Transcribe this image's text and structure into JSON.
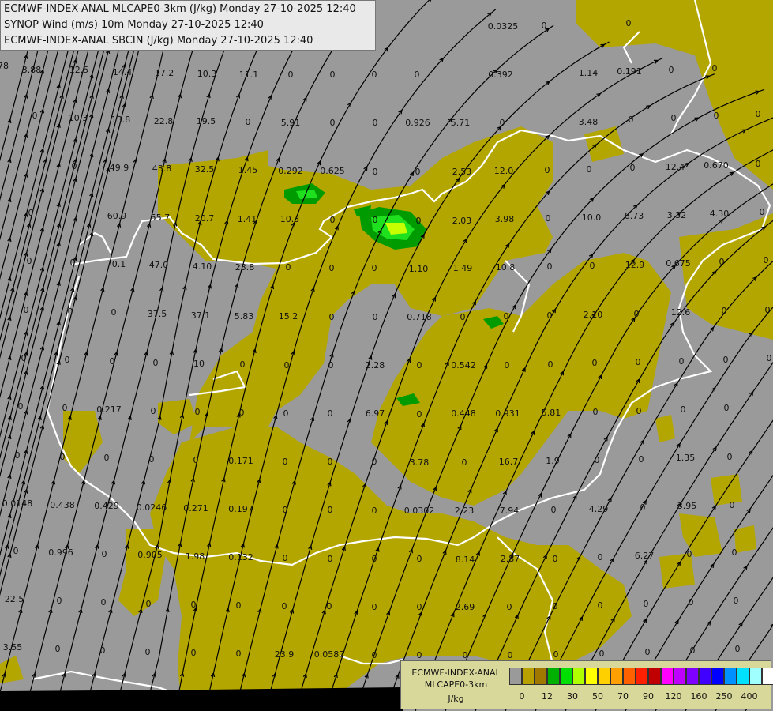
{
  "titles": [
    "ECMWF-INDEX-ANAL MLCAPE0-3km (J/kg) Monday 27-10-2025 12:40",
    "SYNOP Wind (m/s) 10m Monday 27-10-2025 12:40",
    "ECMWF-INDEX-ANAL SBCIN (J/kg) Monday 27-10-2025 12:40"
  ],
  "legend": {
    "line1": "ECMWF-INDEX-ANAL",
    "line2": "MLCAPE0-3km",
    "unit": "J/kg",
    "colors": [
      "#9a9a9a",
      "#b8a000",
      "#a07800",
      "#00b000",
      "#00e000",
      "#b0ff00",
      "#ffff00",
      "#ffd000",
      "#ffa000",
      "#ff6000",
      "#ff2000",
      "#c00000",
      "#ff00ff",
      "#c000ff",
      "#8000ff",
      "#4000ff",
      "#0000ff",
      "#0090ff",
      "#00e0ff",
      "#a0ffff",
      "#ffffff"
    ],
    "ticks": [
      "0",
      "12",
      "30",
      "50",
      "70",
      "90",
      "120",
      "160",
      "250",
      "400"
    ]
  },
  "values": [
    [
      "3.88",
      40,
      92
    ],
    [
      "12.5",
      100,
      92
    ],
    [
      "14.4",
      155,
      95
    ],
    [
      "17.2",
      208,
      96
    ],
    [
      "10.3",
      262,
      97
    ],
    [
      "11.1",
      315,
      98
    ],
    [
      "0",
      368,
      98
    ],
    [
      "0",
      421,
      98
    ],
    [
      "0",
      474,
      98
    ],
    [
      "0",
      528,
      98
    ],
    [
      "0.392",
      634,
      98
    ],
    [
      "1.14",
      745,
      96
    ],
    [
      "0.191",
      797,
      94
    ],
    [
      "0",
      850,
      92
    ],
    [
      "0",
      905,
      90
    ],
    [
      "78",
      4,
      87
    ],
    [
      "0.0325",
      637,
      37
    ],
    [
      "0",
      796,
      33
    ],
    [
      "0",
      689,
      36
    ],
    [
      "0",
      44,
      150
    ],
    [
      "10.3",
      99,
      153
    ],
    [
      "13.8",
      153,
      155
    ],
    [
      "22.8",
      207,
      157
    ],
    [
      "19.5",
      261,
      157
    ],
    [
      "0",
      314,
      158
    ],
    [
      "5.91",
      368,
      159
    ],
    [
      "0",
      421,
      159
    ],
    [
      "0",
      475,
      159
    ],
    [
      "0.926",
      529,
      159
    ],
    [
      "5.71",
      583,
      159
    ],
    [
      "0",
      636,
      159
    ],
    [
      "3.48",
      745,
      158
    ],
    [
      "0",
      799,
      155
    ],
    [
      "0",
      853,
      153
    ],
    [
      "0",
      907,
      150
    ],
    [
      "0",
      960,
      148
    ],
    [
      "0",
      94,
      214
    ],
    [
      "49.9",
      151,
      216
    ],
    [
      "43.8",
      205,
      217
    ],
    [
      "32.5",
      259,
      218
    ],
    [
      "1.45",
      314,
      219
    ],
    [
      "0.292",
      368,
      220
    ],
    [
      "0.625",
      421,
      220
    ],
    [
      "0",
      475,
      221
    ],
    [
      "0",
      529,
      221
    ],
    [
      "2.53",
      585,
      221
    ],
    [
      "12.0",
      638,
      220
    ],
    [
      "0",
      693,
      219
    ],
    [
      "0",
      746,
      218
    ],
    [
      "0",
      801,
      216
    ],
    [
      "12.4",
      855,
      215
    ],
    [
      "0.670",
      907,
      213
    ],
    [
      "0",
      960,
      211
    ],
    [
      "0",
      39,
      273
    ],
    [
      "60.9",
      148,
      277
    ],
    [
      "55.7",
      203,
      279
    ],
    [
      "20.7",
      259,
      280
    ],
    [
      "1.41",
      313,
      281
    ],
    [
      "10.3",
      367,
      281
    ],
    [
      "0",
      421,
      282
    ],
    [
      "0",
      475,
      282
    ],
    [
      "0",
      530,
      283
    ],
    [
      "2.03",
      585,
      283
    ],
    [
      "3.98",
      639,
      281
    ],
    [
      "0",
      694,
      280
    ],
    [
      "10.0",
      749,
      279
    ],
    [
      "6.73",
      803,
      277
    ],
    [
      "3.32",
      857,
      276
    ],
    [
      "4.30",
      911,
      274
    ],
    [
      "0",
      965,
      272
    ],
    [
      "0",
      37,
      334
    ],
    [
      "0",
      92,
      336
    ],
    [
      "70.1",
      147,
      338
    ],
    [
      "47.0",
      201,
      339
    ],
    [
      "4.10",
      256,
      341
    ],
    [
      "23.8",
      310,
      342
    ],
    [
      "0",
      365,
      342
    ],
    [
      "0",
      420,
      343
    ],
    [
      "0",
      474,
      343
    ],
    [
      "1.10",
      530,
      344
    ],
    [
      "1.49",
      586,
      343
    ],
    [
      "10.8",
      640,
      342
    ],
    [
      "0",
      696,
      341
    ],
    [
      "0",
      750,
      340
    ],
    [
      "12.9",
      804,
      339
    ],
    [
      "0.675",
      859,
      337
    ],
    [
      "0",
      914,
      335
    ],
    [
      "0",
      970,
      333
    ],
    [
      "0",
      33,
      396
    ],
    [
      "0",
      89,
      398
    ],
    [
      "0",
      144,
      399
    ],
    [
      "37.5",
      199,
      401
    ],
    [
      "37.1",
      254,
      403
    ],
    [
      "5.83",
      309,
      404
    ],
    [
      "15.2",
      365,
      404
    ],
    [
      "0",
      420,
      405
    ],
    [
      "0",
      475,
      405
    ],
    [
      "0.718",
      531,
      405
    ],
    [
      "0",
      586,
      405
    ],
    [
      "0",
      641,
      404
    ],
    [
      "0",
      696,
      403
    ],
    [
      "2.10",
      751,
      402
    ],
    [
      "0",
      806,
      401
    ],
    [
      "12.6",
      862,
      399
    ],
    [
      "0",
      917,
      397
    ],
    [
      "0",
      972,
      396
    ],
    [
      "0",
      30,
      457
    ],
    [
      "0",
      85,
      459
    ],
    [
      "0",
      142,
      461
    ],
    [
      "0",
      197,
      463
    ],
    [
      "10",
      252,
      464
    ],
    [
      "0",
      307,
      465
    ],
    [
      "0",
      363,
      466
    ],
    [
      "0",
      419,
      466
    ],
    [
      "2.28",
      475,
      466
    ],
    [
      "0",
      531,
      466
    ],
    [
      "0.542",
      587,
      466
    ],
    [
      "0",
      642,
      466
    ],
    [
      "0",
      697,
      465
    ],
    [
      "0",
      753,
      463
    ],
    [
      "0",
      808,
      462
    ],
    [
      "0",
      863,
      461
    ],
    [
      "0",
      919,
      459
    ],
    [
      "0",
      974,
      457
    ],
    [
      "0",
      26,
      518
    ],
    [
      "0",
      82,
      520
    ],
    [
      "0.217",
      138,
      522
    ],
    [
      "0",
      194,
      524
    ],
    [
      "0",
      250,
      525
    ],
    [
      "0",
      306,
      526
    ],
    [
      "0",
      362,
      527
    ],
    [
      "0",
      418,
      527
    ],
    [
      "6.97",
      475,
      527
    ],
    [
      "0",
      531,
      528
    ],
    [
      "0.448",
      587,
      527
    ],
    [
      "0.931",
      643,
      527
    ],
    [
      "5.81",
      698,
      526
    ],
    [
      "0",
      754,
      525
    ],
    [
      "0",
      809,
      524
    ],
    [
      "0",
      865,
      522
    ],
    [
      "0",
      920,
      520
    ],
    [
      "0",
      22,
      580
    ],
    [
      "0",
      79,
      582
    ],
    [
      "0",
      135,
      583
    ],
    [
      "0",
      192,
      585
    ],
    [
      "0",
      248,
      586
    ],
    [
      "0.171",
      305,
      587
    ],
    [
      "0",
      361,
      588
    ],
    [
      "0",
      418,
      588
    ],
    [
      "0",
      474,
      588
    ],
    [
      "3.78",
      531,
      589
    ],
    [
      "0",
      588,
      589
    ],
    [
      "16.7",
      644,
      588
    ],
    [
      "1.9",
      700,
      587
    ],
    [
      "0",
      756,
      586
    ],
    [
      "0",
      812,
      585
    ],
    [
      "1.35",
      868,
      583
    ],
    [
      "0",
      924,
      582
    ],
    [
      "0.0148",
      22,
      641
    ],
    [
      "0.438",
      79,
      643
    ],
    [
      "0.429",
      135,
      644
    ],
    [
      "0.0246",
      192,
      646
    ],
    [
      "0.271",
      248,
      647
    ],
    [
      "0.197",
      305,
      648
    ],
    [
      "0",
      361,
      649
    ],
    [
      "0",
      418,
      649
    ],
    [
      "0",
      474,
      650
    ],
    [
      "0.0302",
      531,
      650
    ],
    [
      "2.23",
      588,
      650
    ],
    [
      "7.94",
      645,
      650
    ],
    [
      "0",
      701,
      649
    ],
    [
      "4.29",
      758,
      648
    ],
    [
      "0",
      814,
      646
    ],
    [
      "3.95",
      870,
      644
    ],
    [
      "0",
      927,
      643
    ],
    [
      "0",
      20,
      701
    ],
    [
      "0.996",
      77,
      703
    ],
    [
      "0",
      132,
      705
    ],
    [
      "0.905",
      190,
      706
    ],
    [
      "1.98",
      247,
      708
    ],
    [
      "0.132",
      305,
      709
    ],
    [
      "0",
      361,
      710
    ],
    [
      "0",
      418,
      711
    ],
    [
      "0",
      474,
      711
    ],
    [
      "0",
      531,
      711
    ],
    [
      "8.14",
      589,
      712
    ],
    [
      "2.87",
      646,
      711
    ],
    [
      "0",
      703,
      711
    ],
    [
      "0",
      760,
      709
    ],
    [
      "6.27",
      816,
      707
    ],
    [
      "0",
      873,
      705
    ],
    [
      "0",
      930,
      703
    ],
    [
      "22.5",
      18,
      762
    ],
    [
      "0",
      75,
      764
    ],
    [
      "0",
      131,
      766
    ],
    [
      "0",
      188,
      768
    ],
    [
      "0",
      245,
      769
    ],
    [
      "0",
      302,
      770
    ],
    [
      "0",
      360,
      771
    ],
    [
      "0",
      417,
      771
    ],
    [
      "0",
      474,
      772
    ],
    [
      "0",
      531,
      772
    ],
    [
      "2.69",
      589,
      772
    ],
    [
      "0",
      645,
      772
    ],
    [
      "0",
      703,
      771
    ],
    [
      "0",
      760,
      770
    ],
    [
      "0",
      818,
      768
    ],
    [
      "0",
      875,
      766
    ],
    [
      "0",
      932,
      764
    ],
    [
      "3.55",
      16,
      823
    ],
    [
      "0",
      73,
      825
    ],
    [
      "0",
      130,
      827
    ],
    [
      "0",
      187,
      829
    ],
    [
      "0",
      245,
      830
    ],
    [
      "0",
      302,
      831
    ],
    [
      "23.9",
      360,
      832
    ],
    [
      "0.0587",
      417,
      832
    ],
    [
      "0",
      474,
      833
    ],
    [
      "0",
      531,
      833
    ],
    [
      "0",
      589,
      833
    ],
    [
      "0",
      646,
      833
    ],
    [
      "0",
      704,
      832
    ],
    [
      "0",
      762,
      831
    ],
    [
      "0",
      820,
      829
    ],
    [
      "0",
      877,
      827
    ],
    [
      "0",
      934,
      825
    ]
  ]
}
